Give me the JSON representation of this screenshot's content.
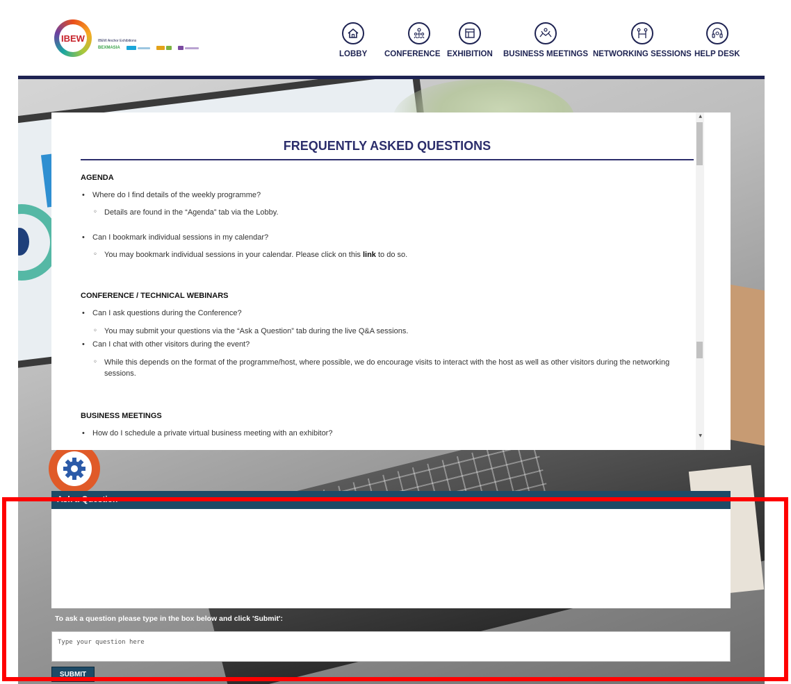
{
  "header": {
    "logo_text": "IBEW",
    "anchor_title": "IBEW Anchor Exhibitions",
    "anchor_logos": [
      "BEXMASIA",
      "",
      "",
      ""
    ],
    "nav": [
      {
        "label": "LOBBY",
        "icon": "home-icon"
      },
      {
        "label": "CONFERENCE",
        "icon": "audience-icon"
      },
      {
        "label": "EXHIBITION",
        "icon": "booth-icon"
      },
      {
        "label": "BUSINESS MEETINGS",
        "icon": "handshake-icon"
      },
      {
        "label": "NETWORKING SESSIONS",
        "icon": "people-network-icon"
      },
      {
        "label": "HELP DESK",
        "icon": "headset-icon"
      }
    ]
  },
  "faq": {
    "title": "FREQUENTLY ASKED QUESTIONS",
    "sections": [
      {
        "heading": "AGENDA",
        "items": [
          {
            "q": "Where do I find details of the weekly programme?",
            "a": "Details are found in the “Agenda” tab via the Lobby."
          },
          {
            "q": "Can I bookmark individual sessions in my calendar?",
            "a_before": "You may bookmark individual sessions in your calendar. Please click on this ",
            "a_link": "link",
            "a_after": " to do so."
          }
        ]
      },
      {
        "heading": "CONFERENCE / TECHNICAL WEBINARS",
        "items": [
          {
            "q": "Can I ask questions during the Conference?",
            "a": "You may submit your questions via the “Ask a Question” tab during the live Q&A sessions."
          },
          {
            "q": "Can I chat with other visitors during the event?",
            "a": "While this depends on the format of the programme/host, where possible, we do encourage visits to interact with the host as well as other visitors during the networking sessions."
          }
        ]
      },
      {
        "heading": "BUSINESS MEETINGS",
        "items": [
          {
            "q": "How do I schedule a private virtual business meeting with an exhibitor?"
          }
        ]
      }
    ]
  },
  "ask": {
    "heading": "Ask a Question",
    "instruction": "To ask a question please type in the box below and click 'Submit':",
    "placeholder": "Type your question here",
    "submit_label": "SUBMIT"
  },
  "colors": {
    "navy": "#1e2352",
    "faq_title": "#2b2d6b",
    "ask_header": "#1d4a66",
    "highlight": "#ff0000"
  }
}
